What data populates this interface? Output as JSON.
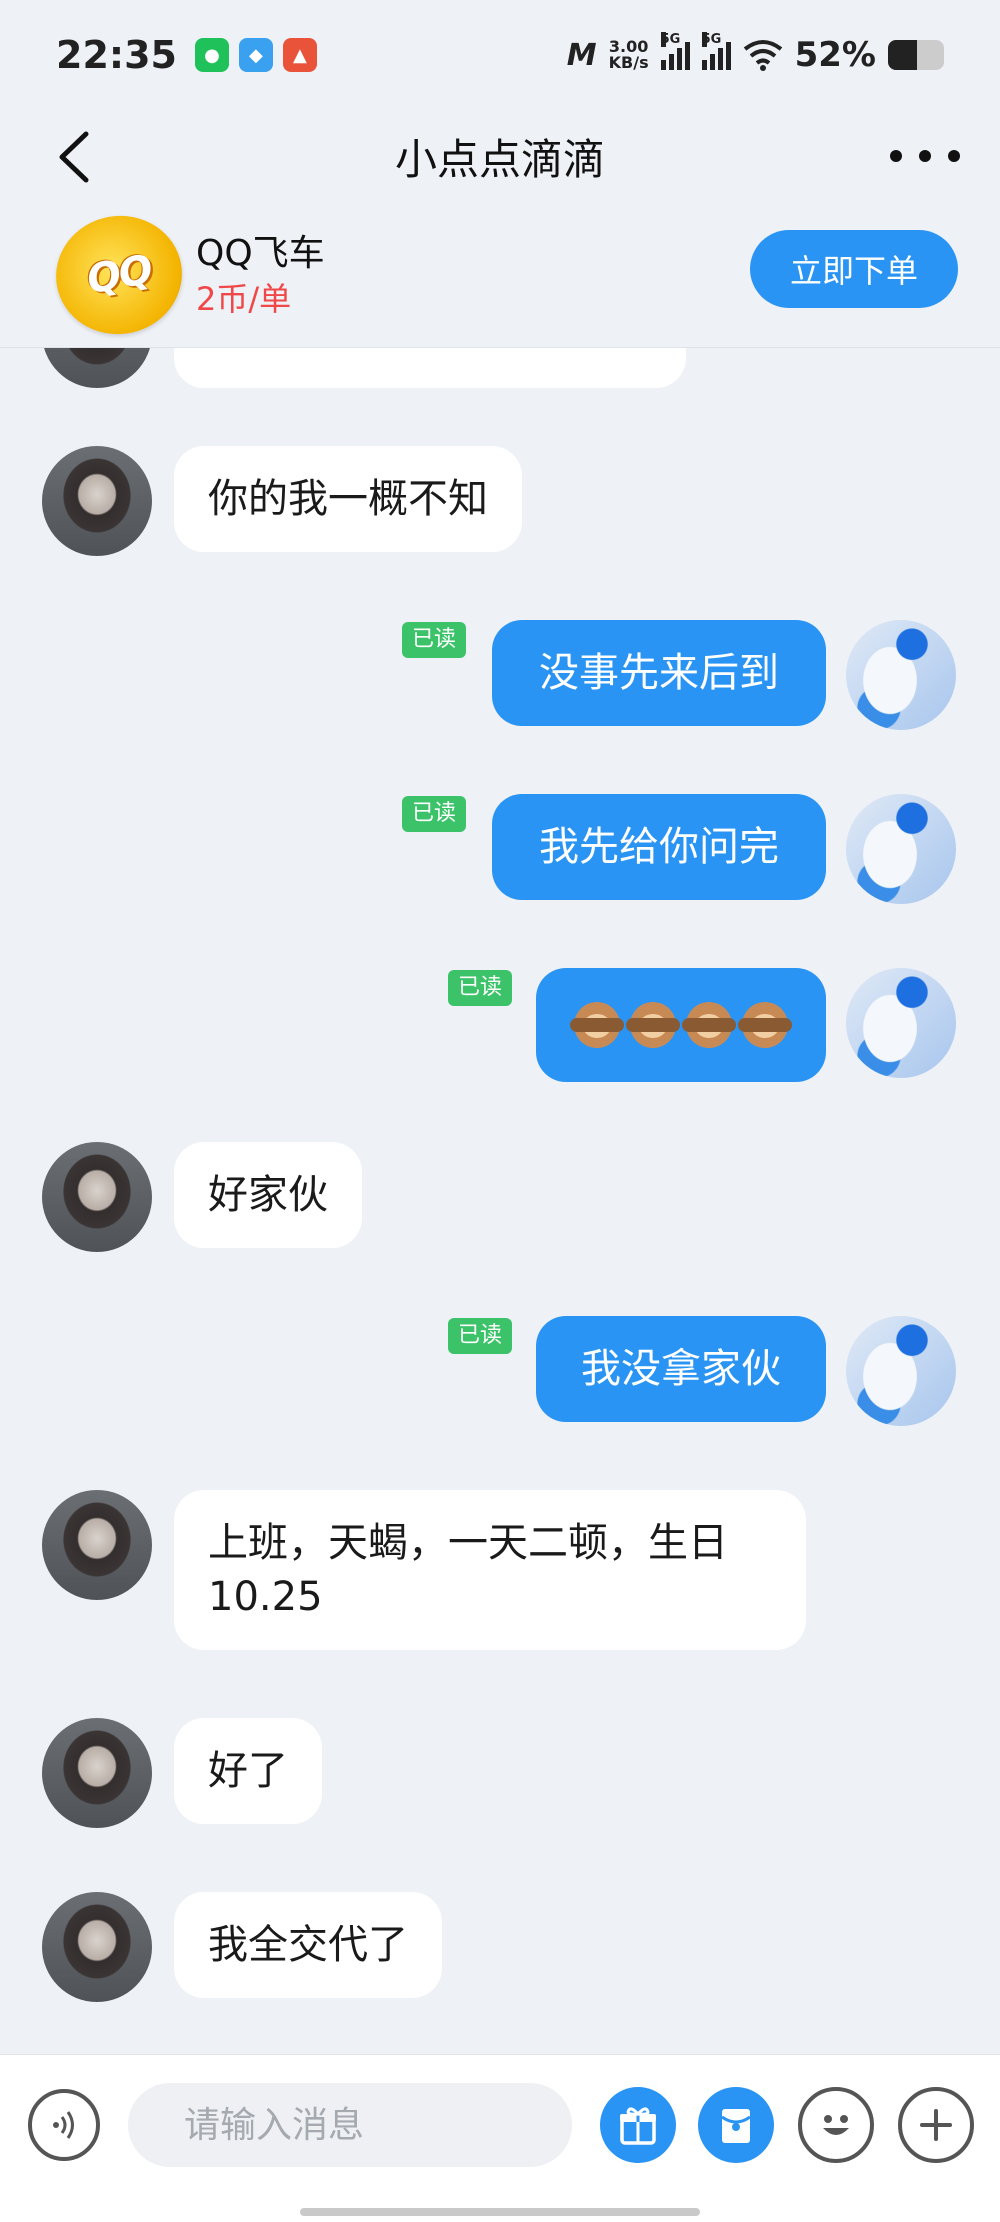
{
  "status_bar": {
    "time": "22:35",
    "net_speed_value": "3.00",
    "net_speed_unit": "KB/s",
    "sim1_label": "5G",
    "sim2_label": "5G",
    "battery_percent": "52%",
    "battery_level": 0.52,
    "app_icons": [
      "wechat-icon",
      "qq-icon",
      "game-icon"
    ]
  },
  "header": {
    "title": "小点点滴滴"
  },
  "banner": {
    "game_name": "QQ飞车",
    "price": "2币/单",
    "order_button": "立即下单",
    "logo_text": "QQ飞车"
  },
  "messages": [
    {
      "side": "in",
      "text": "你的我一概不知"
    },
    {
      "side": "out",
      "text": "没事先来后到",
      "read": "已读"
    },
    {
      "side": "out",
      "text": "我先给你问完",
      "read": "已读"
    },
    {
      "side": "out",
      "emoji": [
        "monkey-see-no-evil",
        "monkey-see-no-evil",
        "monkey-see-no-evil",
        "monkey-see-no-evil"
      ],
      "read": "已读"
    },
    {
      "side": "in",
      "text": "好家伙"
    },
    {
      "side": "out",
      "text": "我没拿家伙",
      "read": "已读"
    },
    {
      "side": "in",
      "text": "上班，天蝎，一天二顿，生日10.25"
    },
    {
      "side": "in",
      "text": "好了"
    },
    {
      "side": "in",
      "text": "我全交代了"
    }
  ],
  "input_bar": {
    "placeholder": "请输入消息"
  },
  "colors": {
    "accent": "#2a94f4",
    "read_tag": "#3cc36a",
    "price": "#f04848",
    "background": "#eef1f6"
  }
}
